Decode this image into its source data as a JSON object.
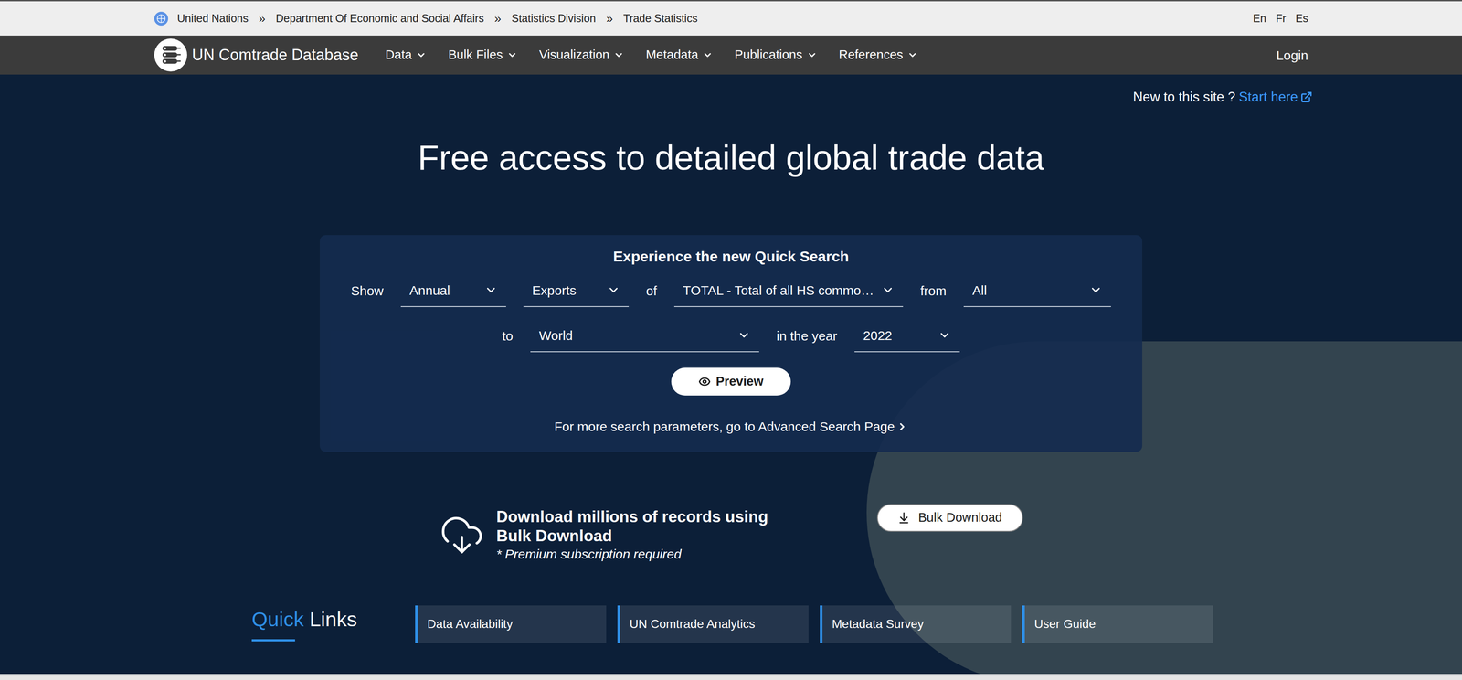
{
  "breadcrumbs": [
    {
      "text": "United Nations"
    },
    {
      "text": "Department Of Economic and Social Affairs"
    },
    {
      "text": "Statistics Division"
    },
    {
      "text": "Trade Statistics"
    }
  ],
  "breadcrumb_separator": "»",
  "languages": [
    {
      "code": "En"
    },
    {
      "code": "Fr"
    },
    {
      "code": "Es"
    }
  ],
  "nav": {
    "brand": "UN Comtrade Database",
    "items": [
      "Data",
      "Bulk Files",
      "Visualization",
      "Metadata",
      "Publications",
      "References"
    ],
    "login": "Login"
  },
  "start_here": {
    "prompt": "New to this site ?",
    "link": "Start here"
  },
  "heading": "Free access to detailed global trade data",
  "quick_search": {
    "title": "Experience the new Quick Search",
    "rows": [
      {
        "items": [
          {
            "kind": "label",
            "text": "Show"
          },
          {
            "kind": "select",
            "text": "Annual",
            "size": "s"
          },
          {
            "kind": "select",
            "text": "Exports",
            "size": "s"
          },
          {
            "kind": "label",
            "text": "of"
          },
          {
            "kind": "select",
            "text": "TOTAL - Total of all HS commo…",
            "size": "l"
          },
          {
            "kind": "label",
            "text": "from"
          },
          {
            "kind": "select",
            "text": "All",
            "size": "m"
          }
        ]
      },
      {
        "items": [
          {
            "kind": "label",
            "text": "to"
          },
          {
            "kind": "select",
            "text": "World",
            "size": "l"
          },
          {
            "kind": "label",
            "text": "in the year"
          },
          {
            "kind": "select",
            "text": "2022",
            "size": "s"
          }
        ]
      }
    ],
    "preview_button": "Preview",
    "advanced_link": "For more search parameters, go to Advanced Search Page"
  },
  "bulk": {
    "title": "Download millions of records using Bulk Download",
    "note": "* Premium subscription required",
    "button": "Bulk Download"
  },
  "quick_links": {
    "title_accent": "Quick",
    "title_rest": "Links",
    "items": [
      "Data Availability",
      "UN Comtrade Analytics",
      "Metadata Survey",
      "User Guide"
    ]
  }
}
